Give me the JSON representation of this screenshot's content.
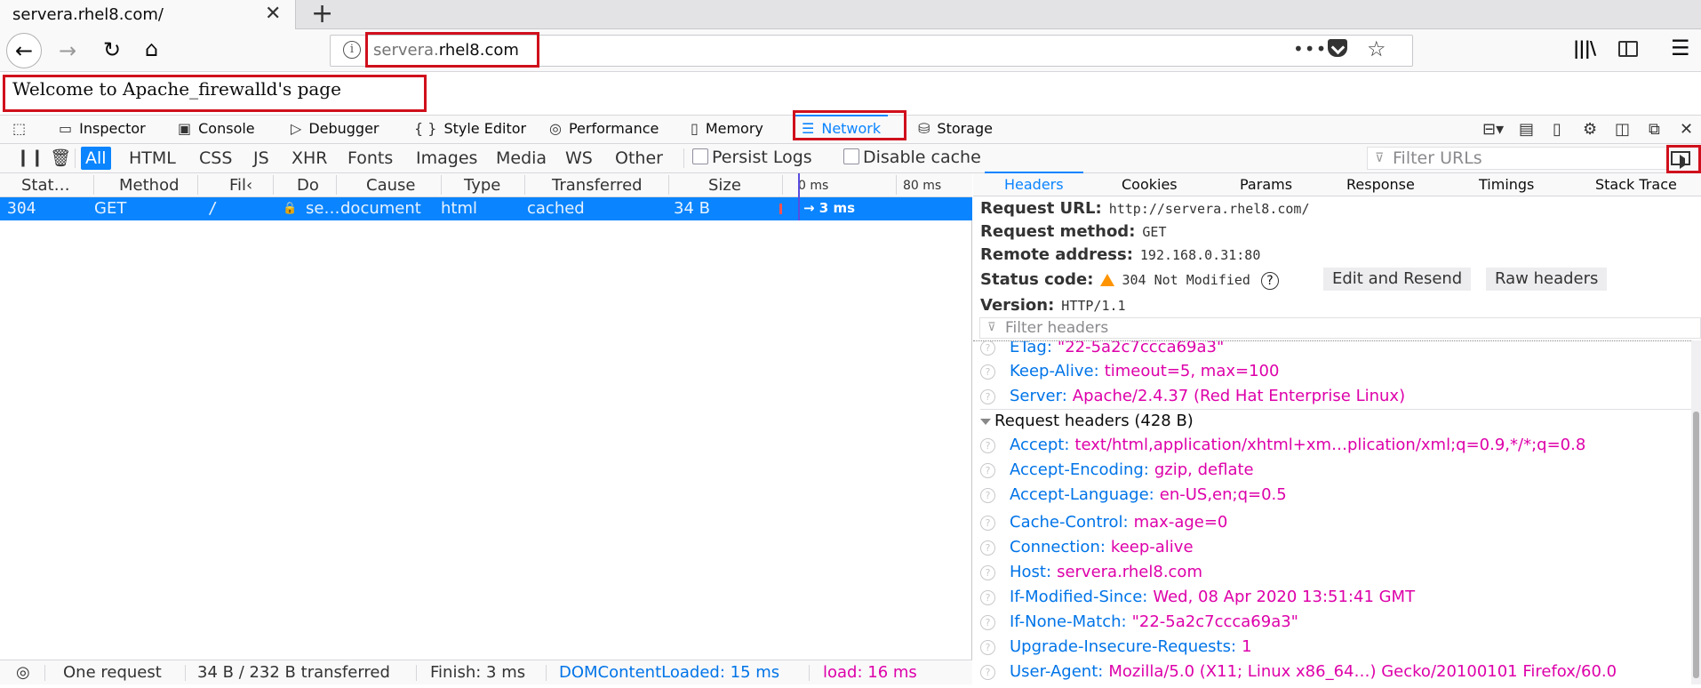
{
  "browser": {
    "tab_title": "servera.rhel8.com/",
    "tab_close": "✕",
    "new_tab": "+",
    "url_domain": "servera.",
    "url_host": "rhel8.com",
    "url_dots": "•••"
  },
  "page": {
    "heading": "Welcome to Apache_firewalld's page"
  },
  "devtools": {
    "tools": [
      "Inspector",
      "Console",
      "Debugger",
      "Style Editor",
      "Performance",
      "Memory",
      "Network",
      "Storage"
    ],
    "selected_tool": "Network"
  },
  "filter_bar": {
    "types": [
      "All",
      "HTML",
      "CSS",
      "JS",
      "XHR",
      "Fonts",
      "Images",
      "Media",
      "WS",
      "Other"
    ],
    "active_type": "All",
    "persist_logs": "Persist Logs",
    "disable_cache": "Disable cache",
    "filter_urls_placeholder": "Filter URLs"
  },
  "request_list": {
    "columns": [
      "Stat…",
      "Method",
      "Fil‹",
      "Do",
      "Cause",
      "Type",
      "Transferred",
      "Size"
    ],
    "waterfall_ticks": [
      "0 ms",
      "80 ms"
    ],
    "row": {
      "status": "304",
      "method": "GET",
      "file": "/",
      "domain": "se…",
      "cause": "document",
      "type": "html",
      "transferred": "cached",
      "size": "34 B",
      "timing": "→ 3 ms"
    }
  },
  "status_bar": {
    "requests": "One request",
    "transferred": "34 B / 232 B transferred",
    "finish": "Finish: 3 ms",
    "dom_content_loaded": "DOMContentLoaded: 15 ms",
    "load": "load: 16 ms",
    "colors": {
      "dcl": "#0074e8",
      "load": "#dd00a9"
    }
  },
  "details": {
    "tabs": [
      "Headers",
      "Cookies",
      "Params",
      "Response",
      "Timings",
      "Stack Trace"
    ],
    "selected_tab": "Headers",
    "request_url_label": "Request URL:",
    "request_url": "http://servera.rhel8.com/",
    "request_method_label": "Request method:",
    "request_method": "GET",
    "remote_address_label": "Remote address:",
    "remote_address": "192.168.0.31:80",
    "status_code_label": "Status code:",
    "status_code": "304 Not Modified",
    "edit_resend": "Edit and Resend",
    "raw_headers": "Raw headers",
    "version_label": "Version:",
    "version": "HTTP/1.1",
    "filter_headers_placeholder": "Filter headers",
    "response_headers_tail": [
      {
        "key": "ETag:",
        "value": "\"22-5a2c7ccca69a3\""
      },
      {
        "key": "Keep-Alive:",
        "value": "timeout=5, max=100"
      },
      {
        "key": "Server:",
        "value": "Apache/2.4.37 (Red Hat Enterprise Linux)"
      }
    ],
    "request_headers_title": "Request headers (428 B)",
    "request_headers": [
      {
        "key": "Accept:",
        "value": "text/html,application/xhtml+xm…plication/xml;q=0.9,*/*;q=0.8"
      },
      {
        "key": "Accept-Encoding:",
        "value": "gzip, deflate"
      },
      {
        "key": "Accept-Language:",
        "value": "en-US,en;q=0.5"
      },
      {
        "key": "Cache-Control:",
        "value": "max-age=0"
      },
      {
        "key": "Connection:",
        "value": "keep-alive"
      },
      {
        "key": "Host:",
        "value": "servera.rhel8.com"
      },
      {
        "key": "If-Modified-Since:",
        "value": "Wed, 08 Apr 2020 13:51:41 GMT"
      },
      {
        "key": "If-None-Match:",
        "value": "\"22-5a2c7ccca69a3\""
      },
      {
        "key": "Upgrade-Insecure-Requests:",
        "value": "1"
      },
      {
        "key": "User-Agent:",
        "value": "Mozilla/5.0 (X11; Linux x86_64…) Gecko/20100101 Firefox/60.0"
      }
    ]
  },
  "accent_color": "#0a84ff",
  "highlight_color": "#d0101c"
}
